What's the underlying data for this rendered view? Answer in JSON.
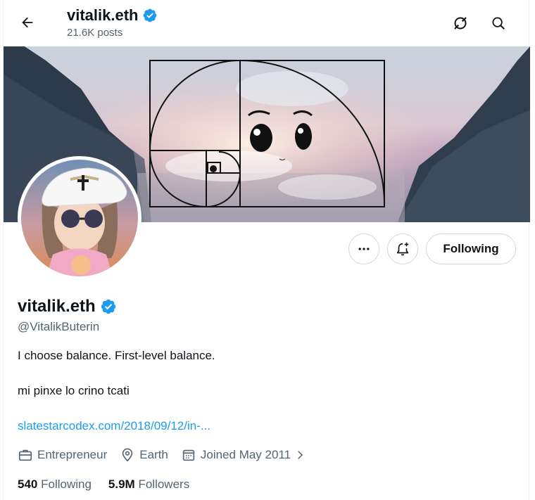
{
  "header": {
    "name": "vitalik.eth",
    "posts": "21.6K posts",
    "back_icon": "arrow-left-icon",
    "grok_icon": "grok-icon",
    "search_icon": "search-icon"
  },
  "profile": {
    "name": "vitalik.eth",
    "handle": "@VitalikButerin",
    "bio_line1": "I choose balance. First-level balance.",
    "bio_line2": "mi pinxe lo crino tcati",
    "link": "slatestarcodex.com/2018/09/12/in-...",
    "occupation": "Entrepreneur",
    "location": "Earth",
    "joined": "Joined May 2011",
    "verified_color": "#1d9bf0"
  },
  "actions": {
    "more_icon": "more-icon",
    "notify_icon": "bell-plus-icon",
    "following_label": "Following"
  },
  "stats": {
    "following_count": "540",
    "following_label": "Following",
    "followers_count": "5.9M",
    "followers_label": "Followers"
  },
  "colors": {
    "accent": "#1d9bf0",
    "secondary_text": "#536471",
    "primary_text": "#0f1419"
  }
}
